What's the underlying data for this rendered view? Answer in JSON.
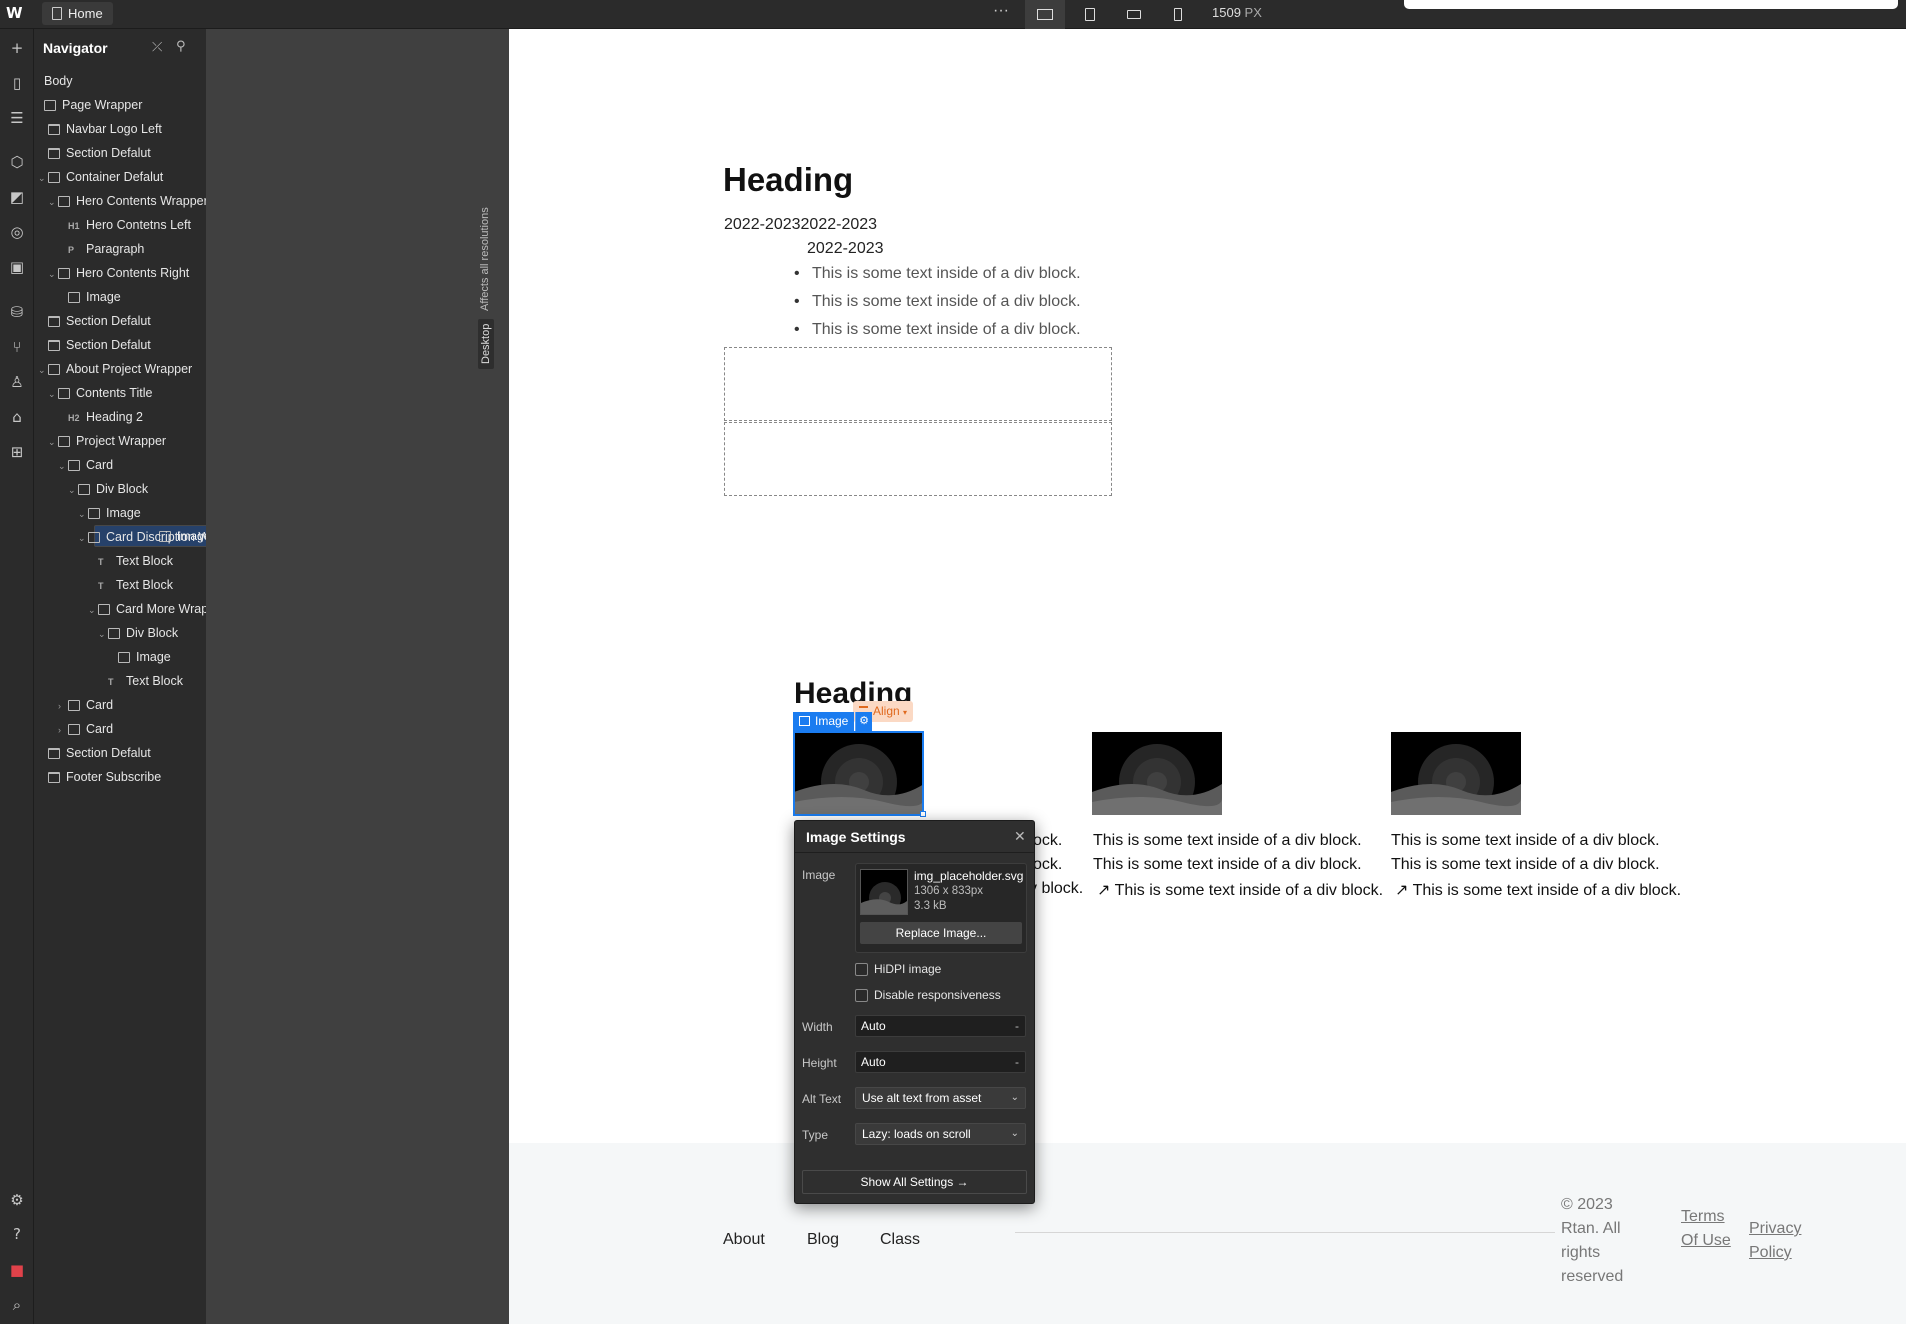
{
  "topbar": {
    "logo": "W",
    "page_tab": "Home",
    "more": "···",
    "width_value": "1509",
    "width_unit": "PX"
  },
  "rail_icons": [
    "add-icon",
    "pages-icon",
    "navigator-icon",
    "components-icon",
    "styles-icon",
    "variables-icon",
    "assets-icon",
    "cms-icon",
    "logic-icon",
    "users-icon",
    "ecommerce-icon",
    "apps-icon",
    "settings-icon",
    "help-icon",
    "record-icon",
    "search-icon"
  ],
  "navigator": {
    "title": "Navigator",
    "items": [
      {
        "label": "Body",
        "indent": 0,
        "type": "body"
      },
      {
        "label": "Page Wrapper",
        "indent": 0,
        "type": "box"
      },
      {
        "label": "Navbar Logo Left",
        "indent": 1,
        "type": "section"
      },
      {
        "label": "Section Defalut",
        "indent": 1,
        "type": "section"
      },
      {
        "label": "Container Defalut",
        "indent": 1,
        "type": "container",
        "open": true
      },
      {
        "label": "Hero Contents Wrapper",
        "indent": 2,
        "type": "box",
        "open": true
      },
      {
        "label": "Hero Contetns Left",
        "indent": 3,
        "type": "h1"
      },
      {
        "label": "Paragraph",
        "indent": 3,
        "type": "p"
      },
      {
        "label": "Hero Contents Right",
        "indent": 2,
        "type": "box",
        "open": true
      },
      {
        "label": "Image",
        "indent": 3,
        "type": "image"
      },
      {
        "label": "Section Defalut",
        "indent": 1,
        "type": "section"
      },
      {
        "label": "Section Defalut",
        "indent": 1,
        "type": "section"
      },
      {
        "label": "About Project Wrapper",
        "indent": 1,
        "type": "container",
        "open": true
      },
      {
        "label": "Contents Title",
        "indent": 2,
        "type": "box",
        "open": true
      },
      {
        "label": "Heading 2",
        "indent": 3,
        "type": "h2"
      },
      {
        "label": "Project Wrapper",
        "indent": 2,
        "type": "box",
        "open": true
      },
      {
        "label": "Card",
        "indent": 3,
        "type": "box",
        "open": true
      },
      {
        "label": "Div Block",
        "indent": 4,
        "type": "box",
        "open": true
      },
      {
        "label": "Image",
        "indent": 5,
        "type": "box",
        "open": true
      },
      {
        "label": "Image",
        "indent": 6,
        "type": "image",
        "selected": true
      },
      {
        "label": "Card Discription Wrapper",
        "indent": 5,
        "type": "box",
        "open": true
      },
      {
        "label": "Text Block",
        "indent": 6,
        "type": "text"
      },
      {
        "label": "Text Block",
        "indent": 6,
        "type": "text"
      },
      {
        "label": "Card More Wrapper",
        "indent": 6,
        "type": "box",
        "open": true
      },
      {
        "label": "Div Block",
        "indent": 7,
        "type": "box",
        "open": true
      },
      {
        "label": "Image",
        "indent": 8,
        "type": "image"
      },
      {
        "label": "Text Block",
        "indent": 7,
        "type": "text"
      },
      {
        "label": "Card",
        "indent": 3,
        "type": "box",
        "open": false
      },
      {
        "label": "Card",
        "indent": 3,
        "type": "box",
        "open": false
      },
      {
        "label": "Section Defalut",
        "indent": 1,
        "type": "section"
      },
      {
        "label": "Footer Subscribe",
        "indent": 1,
        "type": "section"
      }
    ]
  },
  "gutter": {
    "affects": "Affects all resolutions",
    "breakpoint": "Desktop"
  },
  "canvas": {
    "heading": "Heading",
    "years_line1": "2022-20232022-2023",
    "years_line2": "2022-2023",
    "bullets": [
      "This is some text inside of a div block.",
      "This is some text inside of a div block.",
      "This is some text inside of a div block."
    ],
    "heading2": "Heading",
    "cards": [
      {
        "line1": "This is some text inside of a div block.",
        "line2": "This is some text inside of a div block.",
        "line3": "This is some text inside of a div block."
      },
      {
        "line1": "This is some text inside of a div block.",
        "line2": "This is some text inside of a div block.",
        "line3": "This is some text inside of a div block."
      },
      {
        "line1": "This is some text inside of a div block.",
        "line2": "This is some text inside of a div block.",
        "line3": "This is some text inside of a div block."
      }
    ],
    "card1_partial": {
      "line1": "ock.",
      "line2": "ock.",
      "line3": "v block."
    },
    "selection_badge": "Image",
    "align_badge": "Align",
    "footer": {
      "links": [
        "About",
        "Blog",
        "Class"
      ],
      "copyright": "© 2023 Rtan. All rights reserved",
      "terms": "Terms Of Use",
      "privacy": "Privacy Policy"
    }
  },
  "image_settings": {
    "title": "Image Settings",
    "image_label": "Image",
    "file_name": "img_placeholder.svg",
    "dimensions": "1306 x 833px",
    "file_size": "3.3 kB",
    "replace_label": "Replace Image...",
    "hidpi_label": "HiDPI image",
    "disable_resp_label": "Disable responsiveness",
    "width_label": "Width",
    "width_value": "Auto",
    "width_unit": "-",
    "height_label": "Height",
    "height_value": "Auto",
    "height_unit": "-",
    "alt_label": "Alt Text",
    "alt_value": "Use alt text from asset",
    "type_label": "Type",
    "type_value": "Lazy: loads on scroll",
    "show_all": "Show All Settings →"
  }
}
